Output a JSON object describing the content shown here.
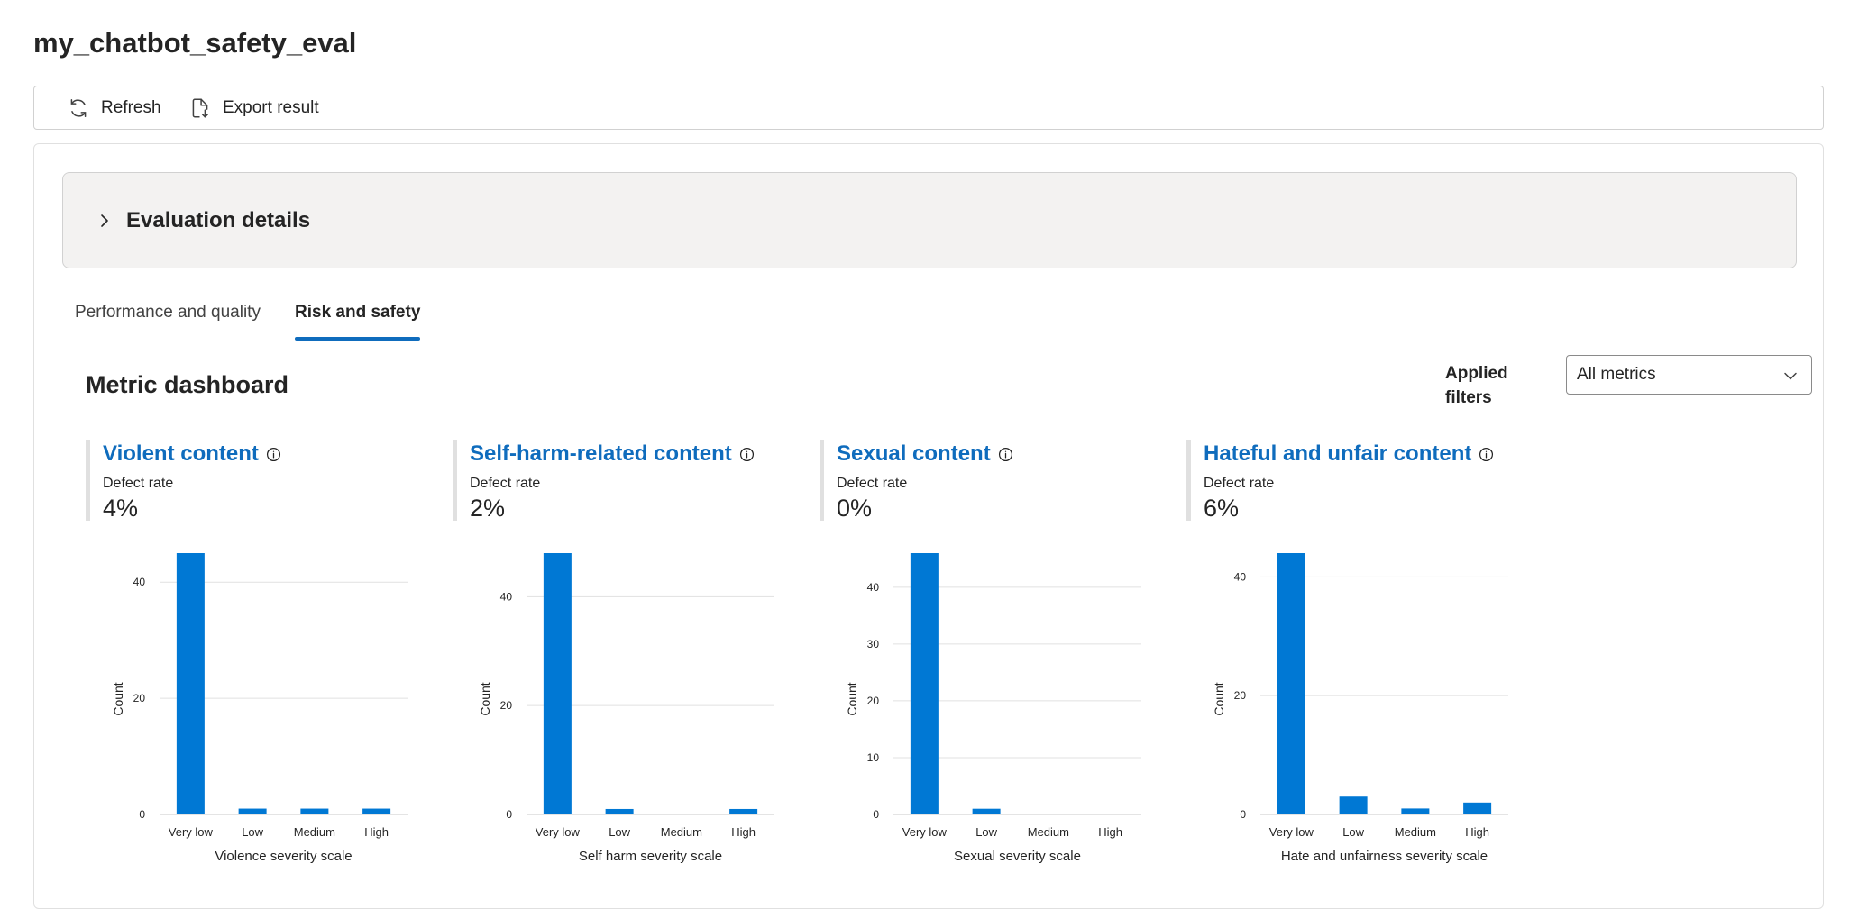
{
  "page": {
    "title": "my_chatbot_safety_eval"
  },
  "toolbar": {
    "refresh_label": "Refresh",
    "export_label": "Export result"
  },
  "accordion": {
    "label": "Evaluation details"
  },
  "tabs": [
    {
      "label": "Performance and quality",
      "active": false
    },
    {
      "label": "Risk and safety",
      "active": true
    }
  ],
  "dashboard": {
    "title": "Metric dashboard",
    "filter_label": "Applied filters",
    "filter_value": "All metrics"
  },
  "colors": {
    "accent": "#0f6cbd",
    "bar": "#0078d4"
  },
  "metrics": [
    {
      "title": "Violent content",
      "sub": "Defect rate",
      "value": "4%"
    },
    {
      "title": "Self-harm-related content",
      "sub": "Defect rate",
      "value": "2%"
    },
    {
      "title": "Sexual content",
      "sub": "Defect rate",
      "value": "0%"
    },
    {
      "title": "Hateful and unfair content",
      "sub": "Defect rate",
      "value": "6%"
    }
  ],
  "chart_data": [
    {
      "type": "bar",
      "categories": [
        "Very low",
        "Low",
        "Medium",
        "High"
      ],
      "values": [
        45,
        1,
        1,
        1
      ],
      "xlabel": "Violence severity scale",
      "ylabel": "Count",
      "yticks": [
        0,
        20,
        40
      ],
      "ylim": [
        0,
        45
      ],
      "grid": true
    },
    {
      "type": "bar",
      "categories": [
        "Very low",
        "Low",
        "Medium",
        "High"
      ],
      "values": [
        48,
        1,
        0,
        1
      ],
      "xlabel": "Self harm severity scale",
      "ylabel": "Count",
      "yticks": [
        0,
        20,
        40
      ],
      "ylim": [
        0,
        48
      ],
      "grid": true
    },
    {
      "type": "bar",
      "categories": [
        "Very low",
        "Low",
        "Medium",
        "High"
      ],
      "values": [
        46,
        1,
        0,
        0
      ],
      "xlabel": "Sexual severity scale",
      "ylabel": "Count",
      "yticks": [
        0,
        10,
        20,
        30,
        40
      ],
      "ylim": [
        0,
        46
      ],
      "grid": true
    },
    {
      "type": "bar",
      "categories": [
        "Very low",
        "Low",
        "Medium",
        "High"
      ],
      "values": [
        44,
        3,
        1,
        2
      ],
      "xlabel": "Hate and unfairness severity scale",
      "ylabel": "Count",
      "yticks": [
        0,
        20,
        40
      ],
      "ylim": [
        0,
        44
      ],
      "grid": true
    }
  ]
}
